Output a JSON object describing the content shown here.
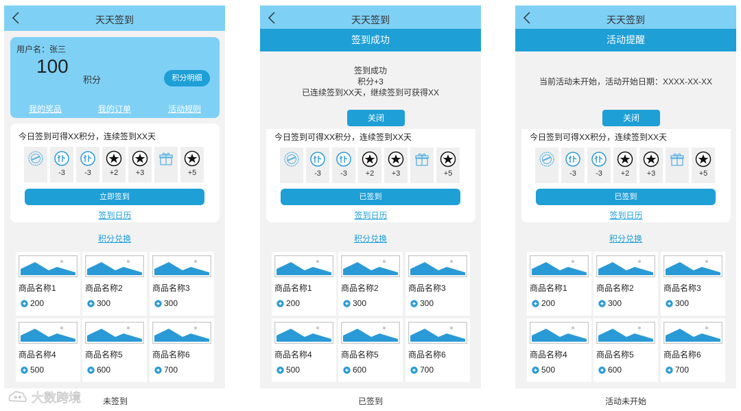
{
  "screens": [
    {
      "title": "天天签到",
      "caption": "未签到",
      "user": {
        "name_label": "用户名：张三",
        "points": "100",
        "points_unit": "积分",
        "detail_button": "积分明细",
        "links": [
          "我的奖品",
          "我的订单",
          "活动规则"
        ]
      },
      "check_text": "今日签到可得XX积分，连续签到XX天",
      "sign_button": "立即签到",
      "calendar_link": "签到日历"
    },
    {
      "title": "天天签到",
      "caption": "已签到",
      "modal": {
        "header": "签到成功",
        "lines": [
          "签到成功",
          "积分+3",
          "已连续签到XX天，继续签到可获得XX"
        ],
        "close": "关闭"
      },
      "check_text": "今日签到可得XX积分，连续签到XX天",
      "sign_button": "已签到",
      "calendar_link": "签到日历"
    },
    {
      "title": "天天签到",
      "caption": "活动未开始",
      "modal": {
        "header": "活动提醒",
        "lines": [
          "当前活动未开始，活动开始日期：XXXX-XX-XX"
        ],
        "close": "关闭"
      },
      "check_text": "今日签到可得XX积分，连续签到XX天",
      "sign_button": "已签到",
      "calendar_link": "签到日历"
    }
  ],
  "days": [
    {
      "icon": "stamp-icon",
      "value": ""
    },
    {
      "icon": "bu-icon",
      "value": "-3"
    },
    {
      "icon": "bu-icon",
      "value": "-3"
    },
    {
      "icon": "star-icon",
      "value": "+2"
    },
    {
      "icon": "star-icon",
      "value": "+3"
    },
    {
      "icon": "gift-icon",
      "value": ""
    },
    {
      "icon": "star-icon",
      "value": "+5"
    }
  ],
  "exchange_link": "积分兑换",
  "products": [
    {
      "name": "商品名称1",
      "price": "200"
    },
    {
      "name": "商品名称2",
      "price": "300"
    },
    {
      "name": "商品名称3",
      "price": "300"
    },
    {
      "name": "商品名称4",
      "price": "500"
    },
    {
      "name": "商品名称5",
      "price": "600"
    },
    {
      "name": "商品名称6",
      "price": "700"
    }
  ],
  "watermark_text": "大数跨境",
  "colors": {
    "header": "#7fd0f5",
    "accent": "#1e9fd6",
    "background": "#f2f2f2"
  }
}
